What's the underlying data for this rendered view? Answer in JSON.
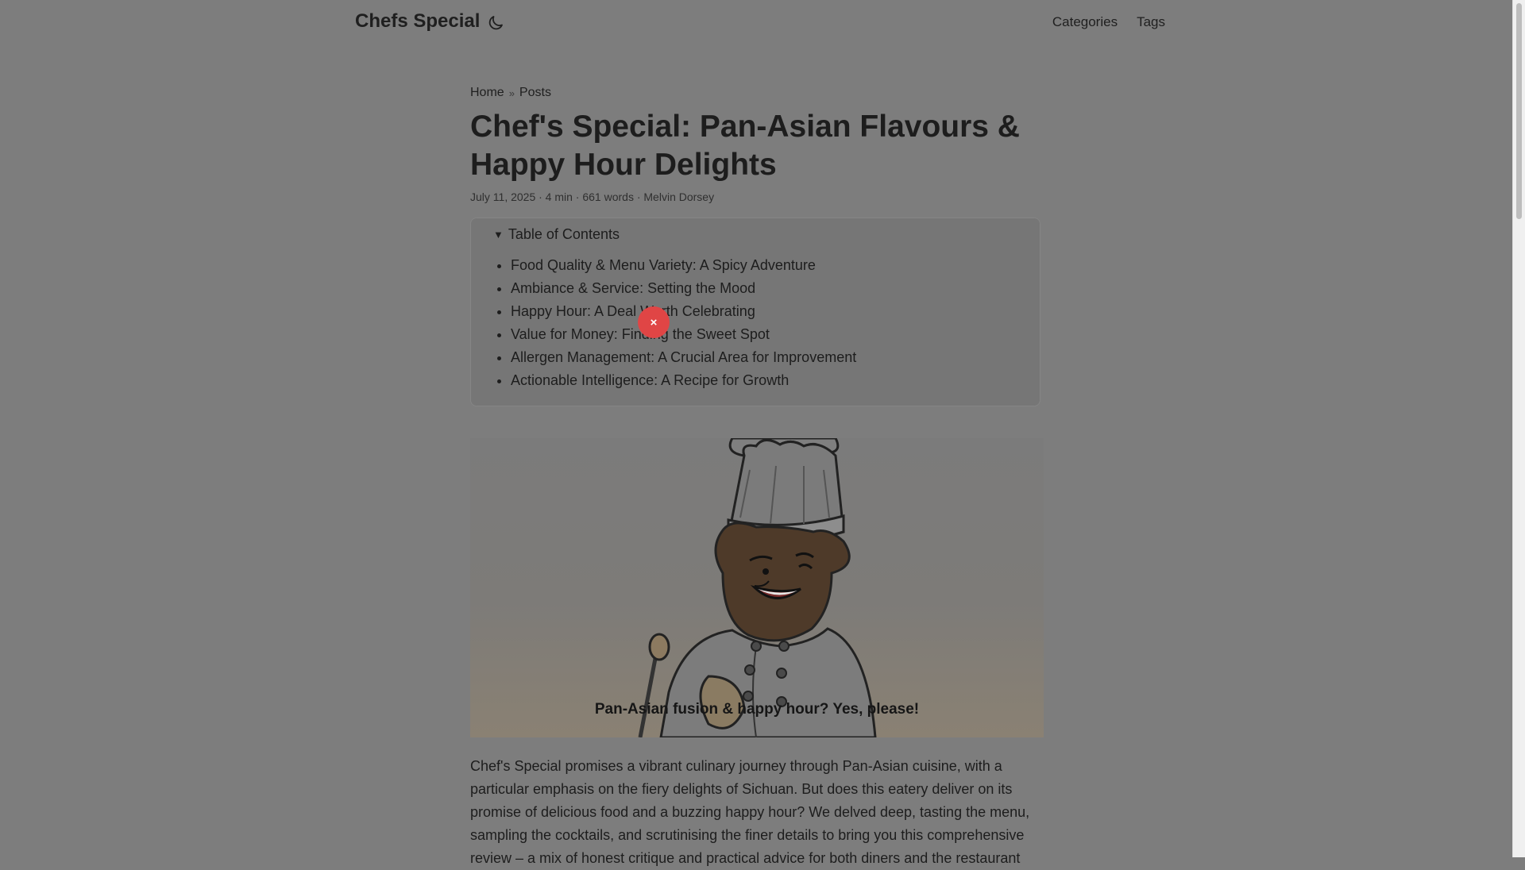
{
  "site": {
    "title": "Chefs Special"
  },
  "nav": {
    "categories": "Categories",
    "tags": "Tags"
  },
  "breadcrumb": {
    "home": "Home",
    "separator": "»",
    "posts": "Posts"
  },
  "article": {
    "title": "Chef's Special: Pan-Asian Flavours & Happy Hour Delights",
    "meta": "July 11, 2025 · 4 min · 661 words · Melvin Dorsey",
    "toc_label": "Table of Contents",
    "toc": [
      "Food Quality & Menu Variety: A Spicy Adventure",
      "Ambiance & Service: Setting the Mood",
      "Happy Hour: A Deal Worth Celebrating",
      "Value for Money: Finding the Sweet Spot",
      "Allergen Management: A Crucial Area for Improvement",
      "Actionable Intelligence: A Recipe for Growth"
    ],
    "image_caption": "Pan-Asian fusion & happy hour? Yes, please!",
    "intro": "Chef's Special promises a vibrant culinary journey through Pan-Asian cuisine, with a particular emphasis on the fiery delights of Sichuan. But does this eatery deliver on its promise of delicious food and a buzzing happy hour? We delved deep, tasting the menu, sampling the cocktails, and scrutinising the finer details to bring you this comprehensive review – a mix of honest critique and practical advice for both diners and the restaurant"
  },
  "modal": {
    "close_symbol": "×"
  },
  "icons": {
    "theme": "moon-icon",
    "close": "close-icon"
  },
  "colors": {
    "overlay": "#7d7d7d",
    "close_button": "#e04545"
  }
}
